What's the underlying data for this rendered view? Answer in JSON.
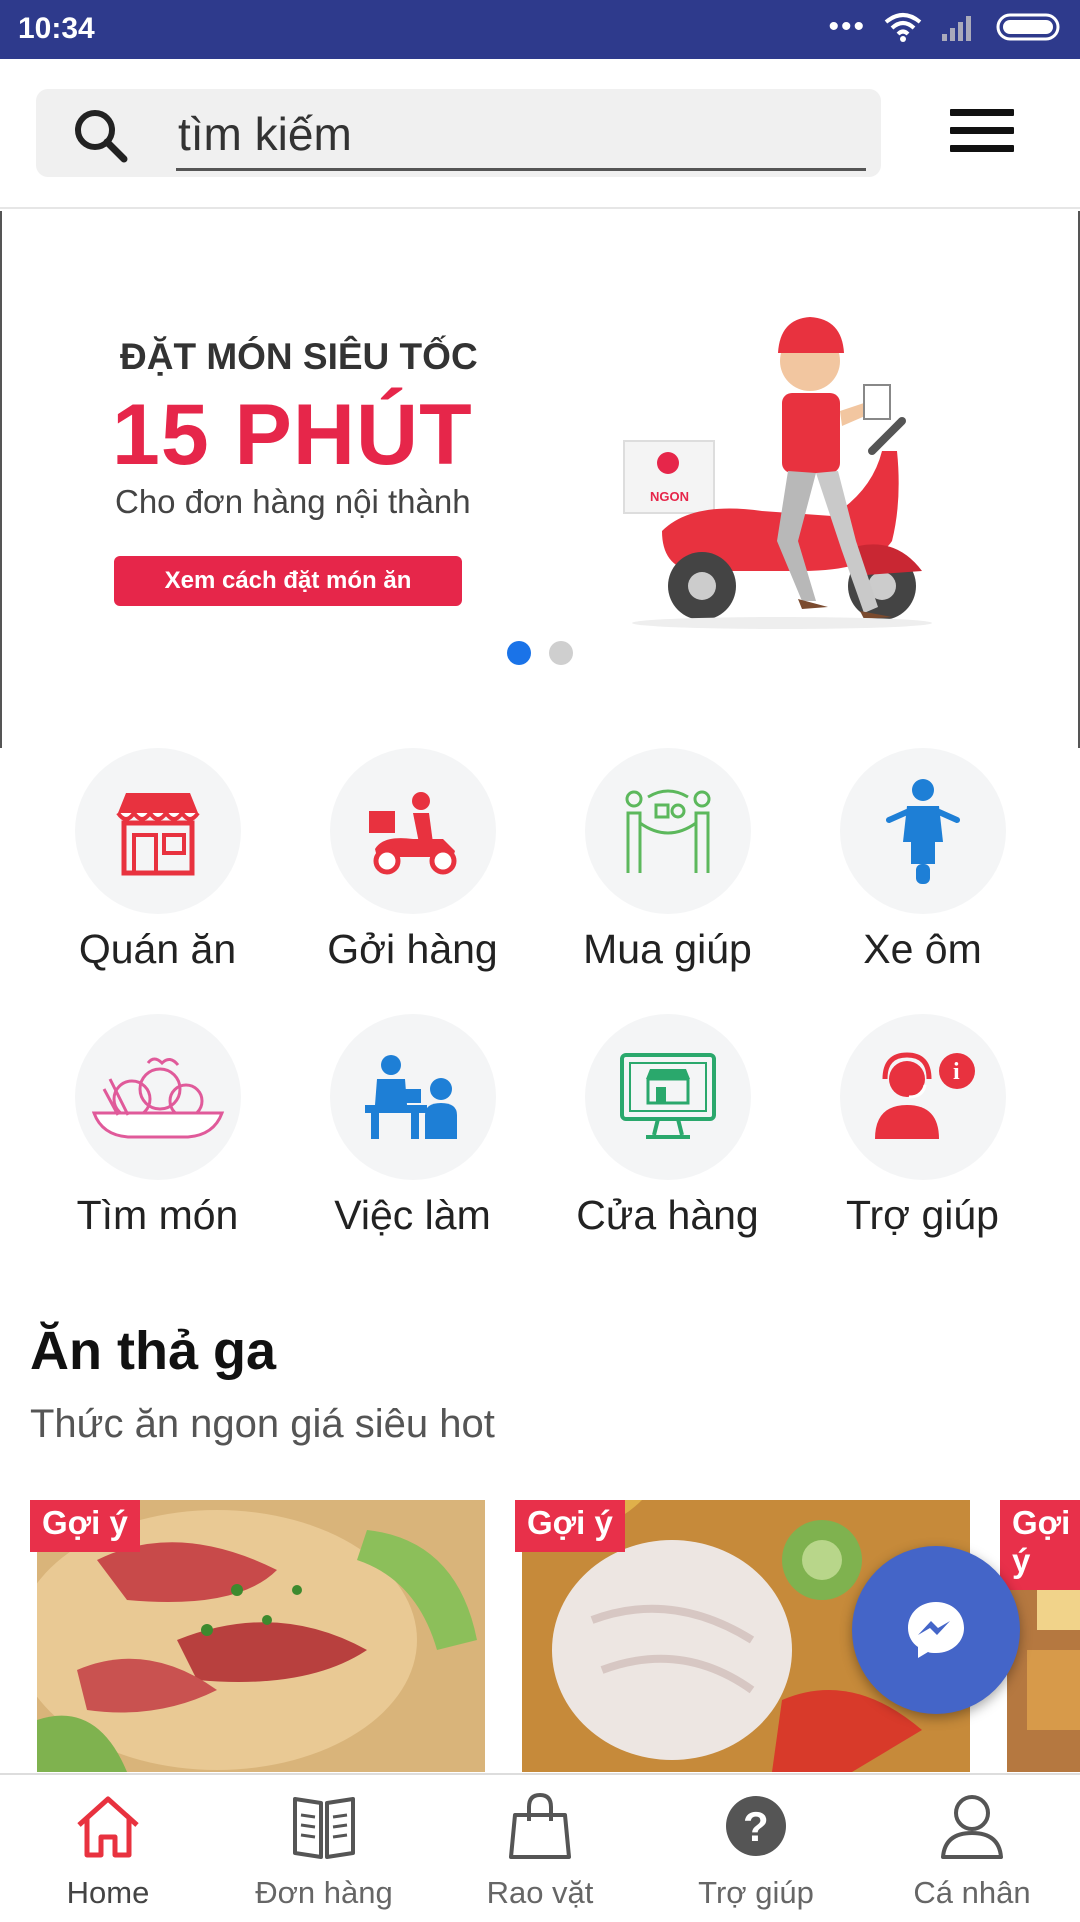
{
  "status_bar": {
    "time": "10:34"
  },
  "search": {
    "placeholder": "tìm kiếm"
  },
  "banner": {
    "line1": "ĐẶT MÓN SIÊU TỐC",
    "line2": "15 PHÚT",
    "line3": "Cho đơn hàng nội thành",
    "cta": "Xem cách đặt món ăn",
    "brand": "NGON",
    "slides_total": 2,
    "active_slide": 1
  },
  "categories": [
    {
      "label": "Quán ăn",
      "icon": "restaurant-icon"
    },
    {
      "label": "Gởi hàng",
      "icon": "delivery-scooter-icon"
    },
    {
      "label": "Mua giúp",
      "icon": "buy-for-me-icon"
    },
    {
      "label": "Xe ôm",
      "icon": "motorbike-taxi-icon"
    },
    {
      "label": "Tìm món",
      "icon": "food-bowl-icon"
    },
    {
      "label": "Việc làm",
      "icon": "job-icon"
    },
    {
      "label": "Cửa hàng",
      "icon": "store-icon"
    },
    {
      "label": "Trợ giúp",
      "icon": "support-icon"
    }
  ],
  "section": {
    "title": "Ăn thả ga",
    "subtitle": "Thức ăn ngon giá siêu hot"
  },
  "cards": [
    {
      "badge": "Gợi ý"
    },
    {
      "badge": "Gợi ý"
    },
    {
      "badge": "Gợi ý"
    }
  ],
  "bottom_nav": [
    {
      "label": "Home",
      "icon": "home-icon",
      "active": true
    },
    {
      "label": "Đơn hàng",
      "icon": "orders-book-icon"
    },
    {
      "label": "Rao vặt",
      "icon": "shopping-bag-icon"
    },
    {
      "label": "Trợ giúp",
      "icon": "help-question-icon"
    },
    {
      "label": "Cá nhân",
      "icon": "user-icon"
    }
  ],
  "colors": {
    "status_bar": "#2e3a8c",
    "accent_red": "#e6264a",
    "active_dot": "#1a73e8",
    "messenger": "#4465c8"
  }
}
